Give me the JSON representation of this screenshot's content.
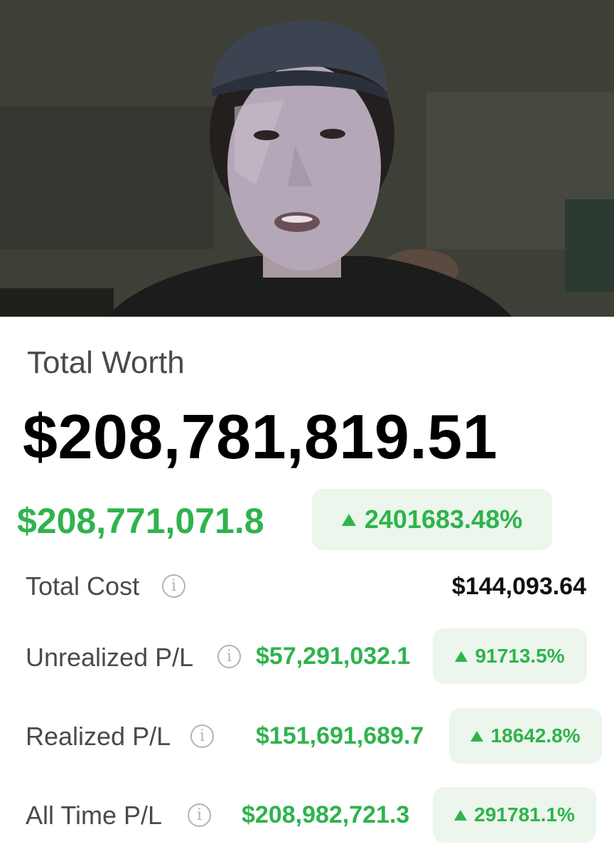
{
  "summary": {
    "title": "Total Worth",
    "total_worth": "$208,781,819.51",
    "total_gain": "$208,771,071.8",
    "total_gain_pct": "2401683.48%"
  },
  "rows": {
    "total_cost": {
      "label": "Total Cost",
      "value": "$144,093.64",
      "info_icon": "i"
    },
    "unrealized": {
      "label": "Unrealized P/L",
      "value": "$57,291,032.1",
      "pct": "91713.5%",
      "info_icon": "i"
    },
    "realized": {
      "label": "Realized P/L",
      "value": "$151,691,689.7",
      "pct": "18642.8%",
      "info_icon": "i"
    },
    "all_time": {
      "label": "All Time P/L",
      "value": "$208,982,721.3",
      "pct": "291781.1%",
      "info_icon": "i"
    }
  },
  "colors": {
    "gain_green": "#2fb34d",
    "pill_bg": "#ecf6ec",
    "label_gray": "#4a4a4a"
  },
  "icons": {
    "info": "info-circle-icon",
    "up": "up-triangle-icon"
  }
}
